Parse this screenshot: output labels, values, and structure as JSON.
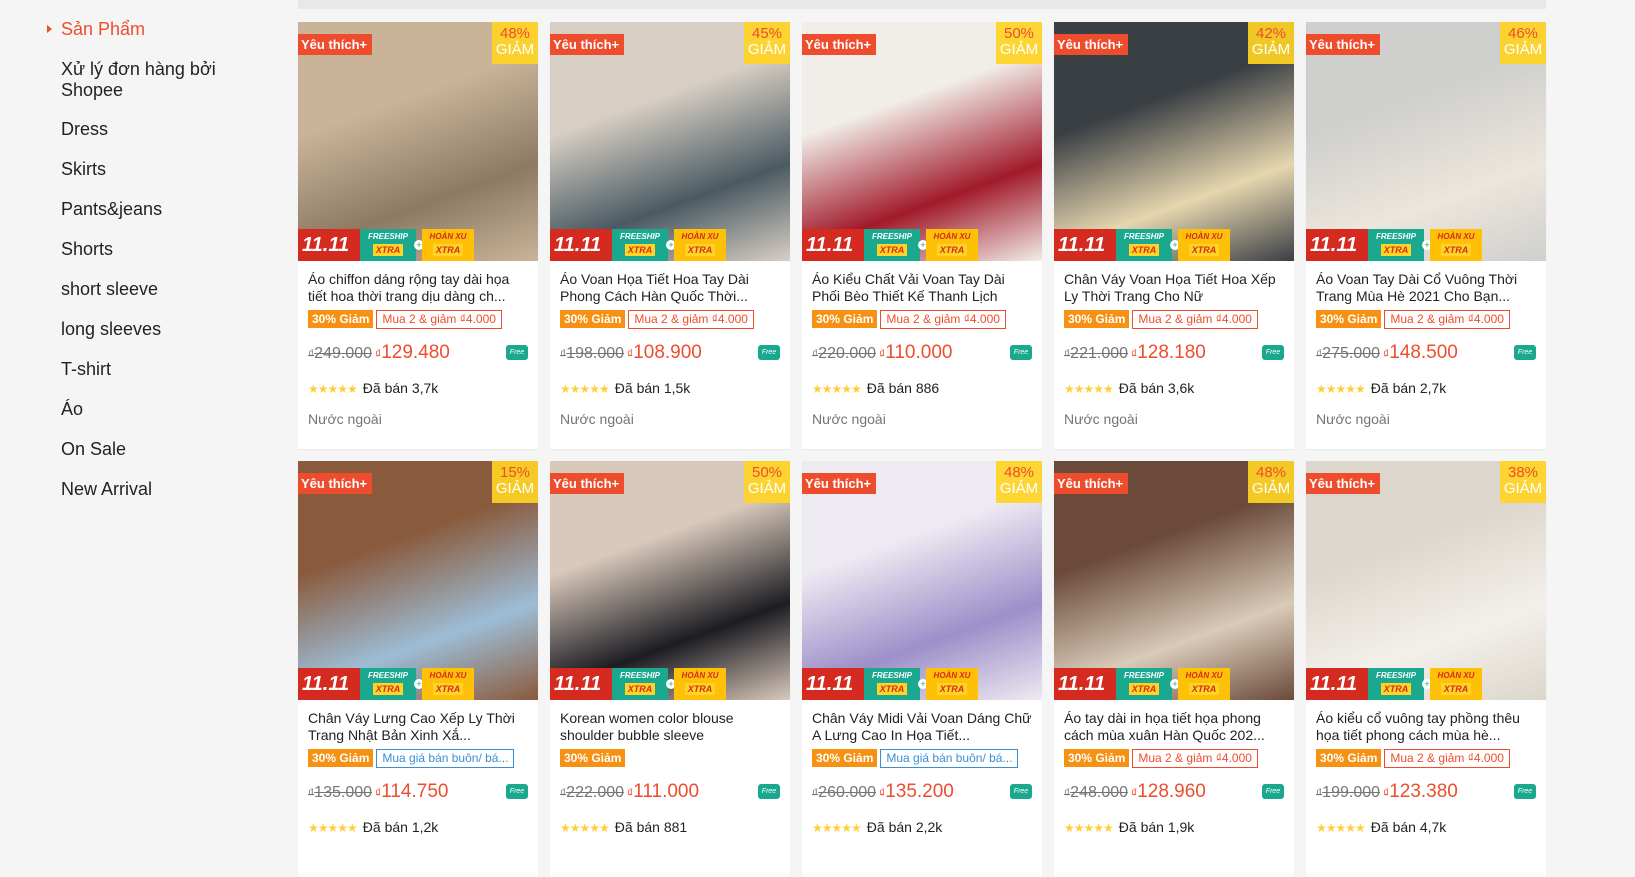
{
  "sidebar": {
    "items": [
      {
        "label": "Sản Phẩm",
        "active": true
      },
      {
        "label": "Xử lý đơn hàng bởi Shopee"
      },
      {
        "label": "Dress"
      },
      {
        "label": "Skirts"
      },
      {
        "label": "Pants&jeans"
      },
      {
        "label": "Shorts"
      },
      {
        "label": "short sleeve"
      },
      {
        "label": "long sleeves"
      },
      {
        "label": "T-shirt"
      },
      {
        "label": "Áo"
      },
      {
        "label": "On Sale"
      },
      {
        "label": "New Arrival"
      }
    ]
  },
  "common": {
    "favorite_label": "Yêu thích+",
    "discount_suffix": "GIẢM",
    "promo_1111": "11.11",
    "promo_freeship": "FREESHIP",
    "promo_xtra": "XTRA",
    "promo_coin": "HOÀN XU",
    "currency": "₫",
    "free_badge": "Free",
    "origin": "Nước ngoài"
  },
  "colors": {
    "accent": "#ee4d2d",
    "sale_tag": "#f69113",
    "discount_badge": "#ffd424",
    "freeship": "#1aa88f",
    "star": "#ffce3d"
  },
  "products": [
    {
      "name": "Áo chiffon dáng rộng tay dài họa tiết hoa thời trang dịu dàng ch...",
      "discount": "48%",
      "sale_tag": "30% Giảm",
      "combo": "Mua 2 & giảm ₫4.000",
      "combo_style": "red",
      "old_price": "249.000",
      "price": "129.480",
      "stars": "★★★★★",
      "sold": "Đã bán 3,7k",
      "origin": "Nước ngoài",
      "img": [
        "#c9b49a",
        "#8e7a64"
      ]
    },
    {
      "name": "Áo Voan Họa Tiết Hoa Tay Dài Phong Cách Hàn Quốc Thời...",
      "discount": "45%",
      "sale_tag": "30% Giảm",
      "combo": "Mua 2 & giảm ₫4.000",
      "combo_style": "red",
      "old_price": "198.000",
      "price": "108.900",
      "stars": "★★★★★",
      "sold": "Đã bán 1,5k",
      "origin": "Nước ngoài",
      "img": [
        "#d8cfc4",
        "#4a5a62"
      ]
    },
    {
      "name": "Áo Kiểu Chất Vải Voan Tay Dài Phối Bèo Thiết Kế Thanh Lịch",
      "discount": "50%",
      "sale_tag": "30% Giảm",
      "combo": "Mua 2 & giảm ₫4.000",
      "combo_style": "red",
      "old_price": "220.000",
      "price": "110.000",
      "stars": "★★★★★",
      "sold": "Đã bán 886",
      "origin": "Nước ngoài",
      "img": [
        "#f1ede8",
        "#a11a2a"
      ]
    },
    {
      "name": "Chân Váy Voan Họa Tiết Hoa Xếp Ly Thời Trang Cho Nữ",
      "discount": "42%",
      "sale_tag": "30% Giảm",
      "combo": "Mua 2 & giảm ₫4.000",
      "combo_style": "red",
      "old_price": "221.000",
      "price": "128.180",
      "stars": "★★★★★",
      "sold": "Đã bán 3,6k",
      "origin": "Nước ngoài",
      "img": [
        "#3a3f44",
        "#e6d6ae"
      ]
    },
    {
      "name": "Áo Voan Tay Dài Cổ Vuông Thời Trang Mùa Hè 2021 Cho Bạn...",
      "discount": "46%",
      "sale_tag": "30% Giảm",
      "combo": "Mua 2 & giảm ₫4.000",
      "combo_style": "red",
      "old_price": "275.000",
      "price": "148.500",
      "stars": "★★★★★",
      "sold": "Đã bán 2,7k",
      "origin": "Nước ngoài",
      "img": [
        "#cfcfcd",
        "#ece6dc"
      ]
    },
    {
      "name": "Chân Váy Lưng Cao Xếp Ly Thời Trang Nhật Bản Xinh Xắ...",
      "discount": "15%",
      "sale_tag": "30% Giảm",
      "combo": "Mua giá bán buôn/ bá...",
      "combo_style": "blue",
      "old_price": "135.000",
      "price": "114.750",
      "stars": "★★★★★",
      "sold": "Đã bán 1,2k",
      "origin": "",
      "img": [
        "#8a5a3c",
        "#9dbdd6"
      ]
    },
    {
      "name": "Korean women color blouse shoulder bubble sleeve",
      "discount": "50%",
      "sale_tag": "30% Giảm",
      "combo": "",
      "combo_style": "none",
      "old_price": "222.000",
      "price": "111.000",
      "stars": "★★★★★",
      "sold": "Đã bán 881",
      "origin": "",
      "img": [
        "#d9c9bb",
        "#1c1c22"
      ]
    },
    {
      "name": "Chân Váy Midi Vải Voan Dáng Chữ A Lưng Cao In Họa Tiết...",
      "discount": "48%",
      "sale_tag": "30% Giảm",
      "combo": "Mua giá bán buôn/ bá...",
      "combo_style": "blue",
      "old_price": "260.000",
      "price": "135.200",
      "stars": "★★★★★",
      "sold": "Đã bán 2,2k",
      "origin": "",
      "img": [
        "#eeeaf2",
        "#9d8fc9"
      ]
    },
    {
      "name": "Áo tay dài in họa tiết họa phong cách mùa xuân Hàn Quốc 202...",
      "discount": "48%",
      "sale_tag": "30% Giảm",
      "combo": "Mua 2 & giảm ₫4.000",
      "combo_style": "red",
      "old_price": "248.000",
      "price": "128.960",
      "stars": "★★★★★",
      "sold": "Đã bán 1,9k",
      "origin": "",
      "img": [
        "#6b4a3a",
        "#d9cbb8"
      ]
    },
    {
      "name": "Áo kiểu cổ vuông tay phồng thêu họa tiết phong cách mùa hè...",
      "discount": "38%",
      "sale_tag": "30% Giảm",
      "combo": "Mua 2 & giảm ₫4.000",
      "combo_style": "red",
      "old_price": "199.000",
      "price": "123.380",
      "stars": "★★★★★",
      "sold": "Đã bán 4,7k",
      "origin": "",
      "img": [
        "#dcd6cc",
        "#f3f0ea"
      ]
    }
  ]
}
